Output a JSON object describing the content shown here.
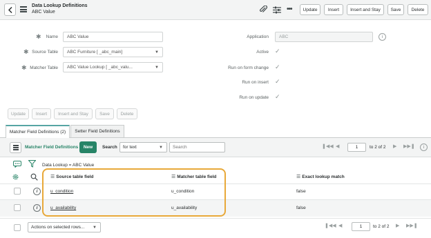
{
  "header": {
    "title": "Data Lookup Definitions",
    "subtitle": "ABC Value",
    "buttons": [
      "Update",
      "Insert",
      "Insert and Stay",
      "Save",
      "Delete"
    ],
    "icons": [
      "paperclip-icon",
      "sliders-icon",
      "more-icon"
    ]
  },
  "form": {
    "name_label": "Name",
    "name_value": "ABC Value",
    "source_table_label": "Source Table",
    "source_table_value": "ABC Furniture [ _abc_main]",
    "matcher_table_label": "Matcher Table",
    "matcher_table_value": "ABC Value Lookup [ _abc_valu...",
    "application_label": "Application",
    "application_value": "ABC",
    "active_label": "Active",
    "run_on_form_change_label": "Run on form change",
    "run_on_insert_label": "Run on insert",
    "run_on_update_label": "Run on update",
    "buttons": [
      "Update",
      "Insert",
      "Insert and Stay",
      "Save",
      "Delete"
    ]
  },
  "tabs": [
    {
      "label": "Matcher Field Definitions (2)",
      "active": true
    },
    {
      "label": "Setter Field Definitions",
      "active": false
    }
  ],
  "list": {
    "title": "Matcher Field Definitions",
    "new_label": "New",
    "search_label": "Search",
    "search_select_value": "for text",
    "search_placeholder": "Search",
    "page_value": "1",
    "page_of": "to 2 of 2",
    "filter_text": "Data Lookup = ABC Value",
    "columns": [
      "Source table field",
      "Matcher table field",
      "Exact lookup match"
    ],
    "rows": [
      {
        "source": "u_condition",
        "matcher": "u_condition",
        "exact": "false"
      },
      {
        "source": "u_availability",
        "matcher": "u_availability",
        "exact": "false"
      }
    ],
    "actions_select": "Actions on selected rows...",
    "footer_page_value": "1",
    "footer_page_of": "to 2 of 2"
  },
  "colors": {
    "accent_green": "#278467",
    "highlight_orange": "#e8a838",
    "tab_accent": "#56a5a3"
  }
}
